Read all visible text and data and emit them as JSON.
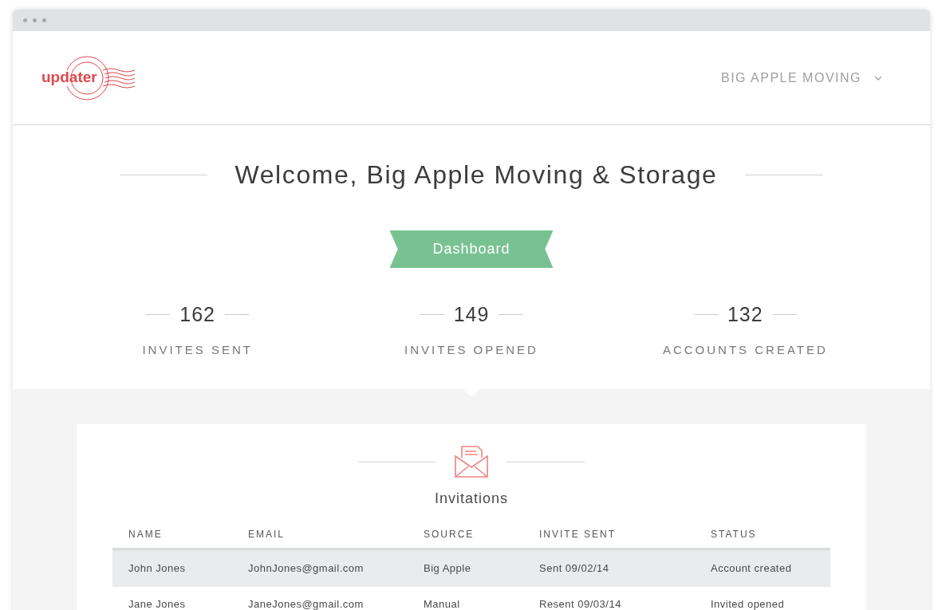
{
  "header": {
    "logo": "updater",
    "account_menu": "BIG APPLE MOVING"
  },
  "welcome": "Welcome, Big Apple Moving & Storage",
  "ribbon": "Dashboard",
  "stats": [
    {
      "value": "162",
      "label": "INVITES SENT"
    },
    {
      "value": "149",
      "label": "INVITES OPENED"
    },
    {
      "value": "132",
      "label": "ACCOUNTS CREATED"
    }
  ],
  "invitations": {
    "title": "Invitations",
    "columns": [
      "NAME",
      "EMAIL",
      "SOURCE",
      "INVITE SENT",
      "STATUS"
    ],
    "rows": [
      {
        "selected": true,
        "cells": [
          "John Jones",
          "JohnJones@gmail.com",
          "Big Apple",
          "Sent 09/02/14",
          "Account created"
        ]
      },
      {
        "selected": false,
        "cells": [
          "Jane Jones",
          "JaneJones@gmail.com",
          "Manual",
          "Resent 09/03/14",
          "Invited opened"
        ]
      }
    ]
  }
}
